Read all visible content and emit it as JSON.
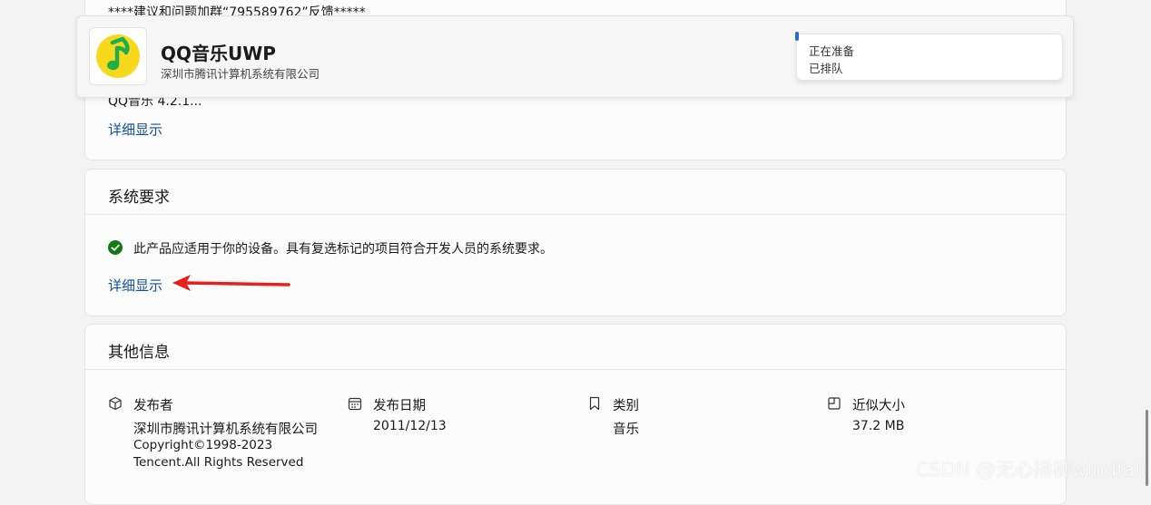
{
  "description": {
    "top_note": "****建议和问题加群“795589762”反馈*****",
    "truncated_text": "QQ音乐 4.2.1...",
    "show_details_label": "详细显示"
  },
  "install_bar": {
    "app_name": "QQ音乐UWP",
    "publisher": "深圳市腾讯计算机系统有限公司",
    "status_primary": "正在准备",
    "status_secondary": "已排队"
  },
  "system_requirements": {
    "title": "系统要求",
    "status_text": "此产品应适用于你的设备。具有复选标记的项目符合开发人员的系统要求。",
    "show_details_label": "详细显示"
  },
  "other_info": {
    "title": "其他信息",
    "publisher": {
      "label": "发布者",
      "value": "深圳市腾讯计算机系统有限公司",
      "copyright": "Copyright©1998-2023",
      "rights": "Tencent.All Rights Reserved"
    },
    "release_date": {
      "label": "发布日期",
      "value": "2011/12/13"
    },
    "category": {
      "label": "类别",
      "value": "音乐"
    },
    "size": {
      "label": "近似大小",
      "value": "37.2 MB"
    }
  },
  "watermark": "CSDN @无心插柳windfall",
  "colors": {
    "link": "#0f4f9a",
    "check_green": "#107c10",
    "arrow_red": "#e8201a",
    "app_icon_yellow": "#f7d81c",
    "app_icon_green": "#1fae4b"
  },
  "icons": {
    "check": "check-circle-icon",
    "arrow": "red-arrow-annotation",
    "publisher": "package-icon",
    "release_date": "calendar-icon",
    "category": "bookmark-icon",
    "size": "size-icon"
  }
}
